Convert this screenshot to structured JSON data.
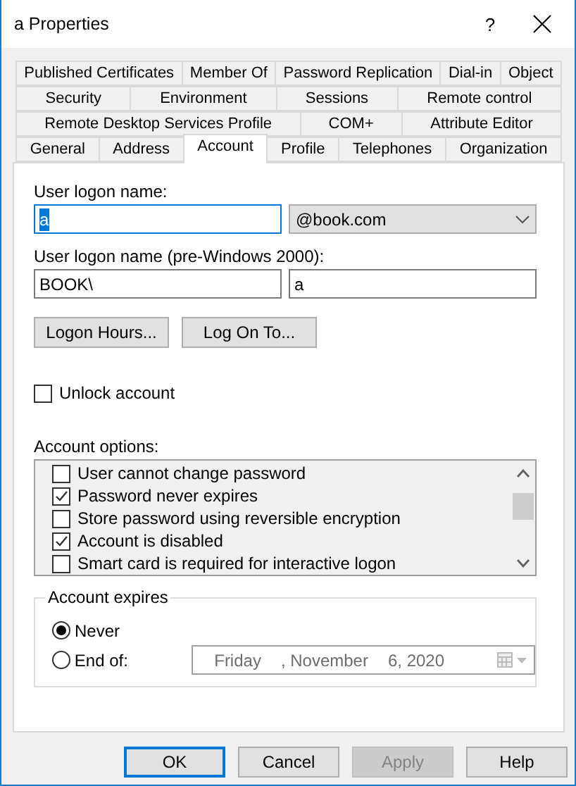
{
  "window": {
    "title": "a Properties",
    "help_label": "?"
  },
  "tab_rows": [
    {
      "tabs": [
        {
          "label": "Published Certificates",
          "selected": false
        },
        {
          "label": "Member Of",
          "selected": false
        },
        {
          "label": "Password Replication",
          "selected": false
        },
        {
          "label": "Dial-in",
          "selected": false
        },
        {
          "label": "Object",
          "selected": false
        }
      ]
    },
    {
      "tabs": [
        {
          "label": "Security",
          "selected": false
        },
        {
          "label": "Environment",
          "selected": false
        },
        {
          "label": "Sessions",
          "selected": false
        },
        {
          "label": "Remote control",
          "selected": false
        }
      ]
    },
    {
      "tabs": [
        {
          "label": "Remote Desktop Services Profile",
          "selected": false
        },
        {
          "label": "COM+",
          "selected": false
        },
        {
          "label": "Attribute Editor",
          "selected": false
        }
      ]
    },
    {
      "tabs": [
        {
          "label": "General",
          "selected": false
        },
        {
          "label": "Address",
          "selected": false
        },
        {
          "label": "Account",
          "selected": true
        },
        {
          "label": "Profile",
          "selected": false
        },
        {
          "label": "Telephones",
          "selected": false
        },
        {
          "label": "Organization",
          "selected": false
        }
      ]
    }
  ],
  "logon": {
    "upn_label": "User logon name:",
    "upn_value": "a",
    "upn_text_selected": true,
    "domain": "@book.com",
    "legacy_label": "User logon name (pre-Windows 2000):",
    "legacy_domain": "BOOK\\",
    "legacy_name": "a"
  },
  "page_buttons": [
    "Logon Hours...",
    "Log On To..."
  ],
  "unlock": {
    "label": "Unlock account",
    "checked": false
  },
  "account_options": {
    "label": "Account options:",
    "items": [
      {
        "label": "User cannot change password",
        "checked": false
      },
      {
        "label": "Password never expires",
        "checked": true
      },
      {
        "label": "Store password using reversible encryption",
        "checked": false
      },
      {
        "label": "Account is disabled",
        "checked": true
      },
      {
        "label": "Smart card is required for interactive logon",
        "checked": false
      }
    ]
  },
  "account_expires": {
    "title": "Account expires",
    "options": [
      {
        "label": "Never",
        "selected": true
      },
      {
        "label": "End of:",
        "selected": false
      }
    ],
    "date_parts": [
      "Friday",
      ", November",
      "6, 2020"
    ],
    "date_disabled": true
  },
  "buttons": [
    {
      "label": "OK",
      "default": true,
      "disabled": false
    },
    {
      "label": "Cancel",
      "default": false,
      "disabled": false
    },
    {
      "label": "Apply",
      "default": false,
      "disabled": true
    },
    {
      "label": "Help",
      "default": false,
      "disabled": false
    }
  ]
}
